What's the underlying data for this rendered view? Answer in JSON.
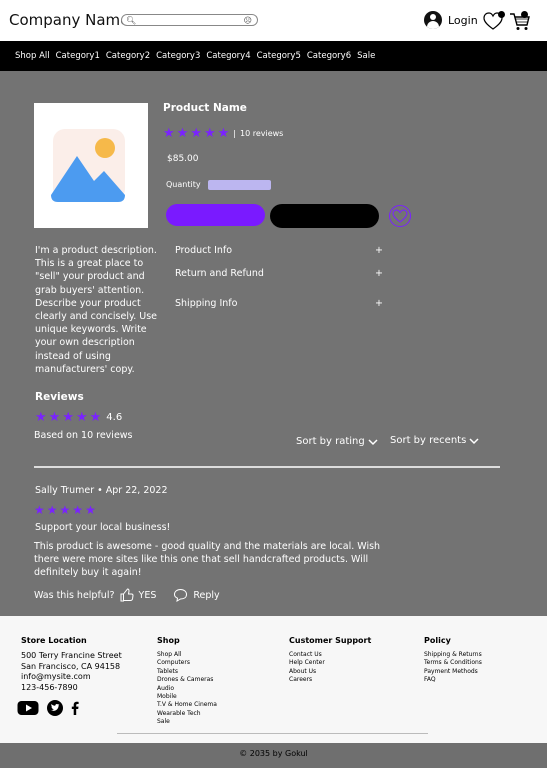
{
  "header": {
    "brand": "Company Name",
    "search_placeholder": "",
    "login_label": "Login"
  },
  "nav": {
    "items": [
      "Shop All",
      "Category1",
      "Category2",
      "Category3",
      "Category4",
      "Category5",
      "Category6",
      "Sale"
    ]
  },
  "product": {
    "name": "Product Name",
    "rating_stars": 5,
    "review_separator": "|",
    "review_count_label": "10 reviews",
    "price": "$85.00",
    "quantity_label": "Quantity",
    "description": "I'm a product description. This is a great place to \"sell\" your product and grab buyers' attention. Describe your product clearly and concisely. Use unique keywords. Write your own description instead of using manufacturers' copy.",
    "accordion": [
      {
        "label": "Product Info",
        "toggle": "+"
      },
      {
        "label": "Return and Refund",
        "toggle": "+"
      },
      {
        "label": "Shipping Info",
        "toggle": "+"
      }
    ]
  },
  "reviews": {
    "title": "Reviews",
    "average": "4.6",
    "based_on": "Based on 10 reviews",
    "sort_rating": "Sort by rating",
    "sort_recents": "Sort by recents",
    "items": [
      {
        "author_date": "Sally Trumer • Apr 22, 2022",
        "stars": 5,
        "title": "Support your local business!",
        "body": "This product is awesome - good quality and the materials are local. Wish there were more sites like this one that sell handcrafted products. Will definitely buy it again!",
        "helpful_label": "Was this helpful?",
        "yes_label": "YES",
        "reply_label": "Reply"
      }
    ]
  },
  "footer": {
    "store": {
      "title": "Store Location",
      "lines": [
        "500 Terry Francine Street",
        "San Francisco, CA 94158",
        "info@mysite.com",
        "123-456-7890"
      ]
    },
    "shop": {
      "title": "Shop",
      "items": [
        "Shop All",
        "Computers",
        "Tablets",
        "Drones & Cameras",
        "Audio",
        "Mobile",
        "T.V & Home Cinema",
        "Wearable Tech",
        "Sale"
      ]
    },
    "support": {
      "title": "Customer Support",
      "items": [
        "Contact Us",
        "Help Center",
        "About Us",
        "Careers"
      ]
    },
    "policy": {
      "title": "Policy",
      "items": [
        "Shipping & Returns",
        "Terms & Conditions",
        "Payment Methods",
        "FAQ"
      ]
    },
    "social_icons": [
      "youtube-icon",
      "twitter-icon",
      "facebook-icon"
    ],
    "copyright": "© 2035 by Gokul"
  },
  "colors": {
    "accent": "#7a22ff",
    "main_bg": "#737373",
    "qty_bg": "#bcb6f0"
  }
}
